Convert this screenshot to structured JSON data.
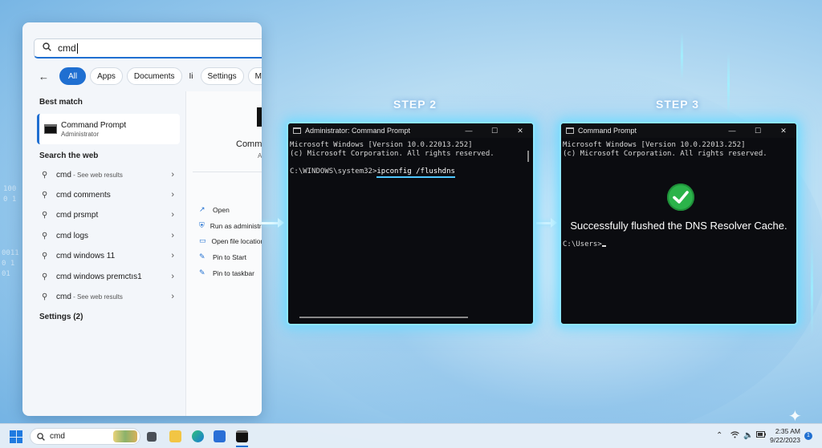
{
  "start_menu": {
    "search": {
      "value": "cmd"
    },
    "filters": [
      "All",
      "Apps",
      "Documents",
      "Ii",
      "Settings",
      "More"
    ],
    "best_match_heading": "Best match",
    "best_match": {
      "title": "Command Prompt",
      "subtitle": "Administrator"
    },
    "web_heading": "Search the web",
    "web_items": [
      {
        "label": "cmd",
        "sub": " - See web results"
      },
      {
        "label": "cmd comments",
        "sub": ""
      },
      {
        "label": "cmd prsmpt",
        "sub": ""
      },
      {
        "label": "cmd logs",
        "sub": ""
      },
      {
        "label": "cmd windows 11",
        "sub": ""
      },
      {
        "label": "cmd windows premctıs1",
        "sub": ""
      },
      {
        "label": "cmd",
        "sub": " - See web results"
      }
    ],
    "settings_heading": "Settings (2)",
    "details": {
      "title": "Comm",
      "subtitle": "A",
      "actions": [
        {
          "icon": "open-icon",
          "label": "Open"
        },
        {
          "icon": "shield-icon",
          "label": "Run as administra"
        },
        {
          "icon": "folder-icon",
          "label": "Open file location"
        },
        {
          "icon": "pin-icon",
          "label": "Pin to Start"
        },
        {
          "icon": "pin-icon",
          "label": "Pin to taskbar"
        }
      ]
    }
  },
  "steps": {
    "step2_label": "STEP 2",
    "step3_label": "STEP 3"
  },
  "terminal_step2": {
    "title": "Administrator: Command Prompt",
    "controls": [
      "—",
      "☐",
      "✕"
    ],
    "line1": "Microsoft Windows [Version 10.0.22013.252]",
    "line2": "(c) Microsoft Corporation. All rights reserved.",
    "prompt": "C:\\WINDOWS\\system32>",
    "command": "ipconfig /flushdns"
  },
  "terminal_step3": {
    "title": "Command Prompt",
    "controls": [
      "—",
      "☐",
      "✕"
    ],
    "line1": "Microsoft Windows [Version 10.0.22013.252]",
    "line2": "(c) Microsoft Corporation. All rights reserved.",
    "success_message": "Successfully flushed the DNS Resolver Cache.",
    "prompt": "C:\\Users>"
  },
  "taskbar": {
    "search_value": "cmd",
    "time": "2:35 AM",
    "date": "9/22/2023",
    "notification_count": "1",
    "accent": "#1f6fd1"
  },
  "background_digits": [
    "100",
    "0 1",
    "0011",
    "0 1",
    "01"
  ]
}
